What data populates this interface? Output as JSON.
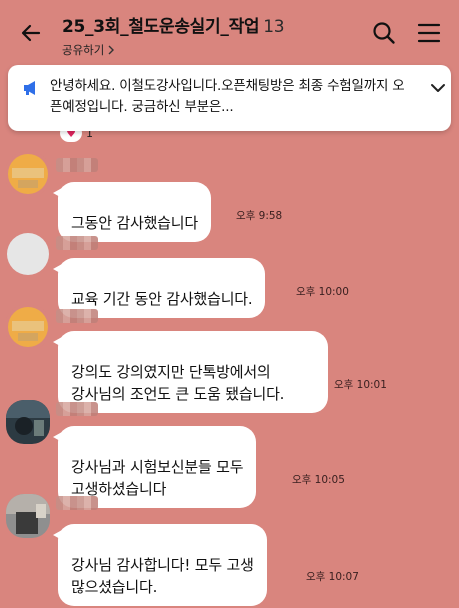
{
  "header": {
    "title": "25_3회_철도운송실기_작업",
    "member_count": "13",
    "share_label": "공유하기"
  },
  "notice": {
    "text": "안녕하세요. 이철도강사입니다.오픈채팅방은 최종 수험일까지 오픈예정입니다. 궁금하신 부분은..."
  },
  "peek": {
    "reaction": "♥",
    "count": "1"
  },
  "messages": [
    {
      "text": "그동안 감사했습니다",
      "time": "오후 9:58"
    },
    {
      "text": "교육 기간 동안 감사했습니다.",
      "time": "오후 10:00"
    },
    {
      "text": "강의도 강의였지만 단톡방에서의\n강사님의 조언도 큰 도움 됐습니다.",
      "time": "오후 10:01"
    },
    {
      "text": "강사님과 시험보신분들 모두\n고생하셨습니다",
      "time": "오후 10:05"
    },
    {
      "text": "강사님 감사합니다!  모두 고생\n많으셨습니다.",
      "time": "오후 10:07"
    }
  ],
  "icons": {
    "back": "arrow-left-icon",
    "search": "search-icon",
    "menu": "hamburger-menu-icon",
    "notice": "megaphone-icon",
    "notice_toggle": "chevron-down-icon"
  },
  "colors": {
    "background": "#d9857e",
    "bubble": "#ffffff",
    "notice_icon": "#2f6fe8"
  }
}
